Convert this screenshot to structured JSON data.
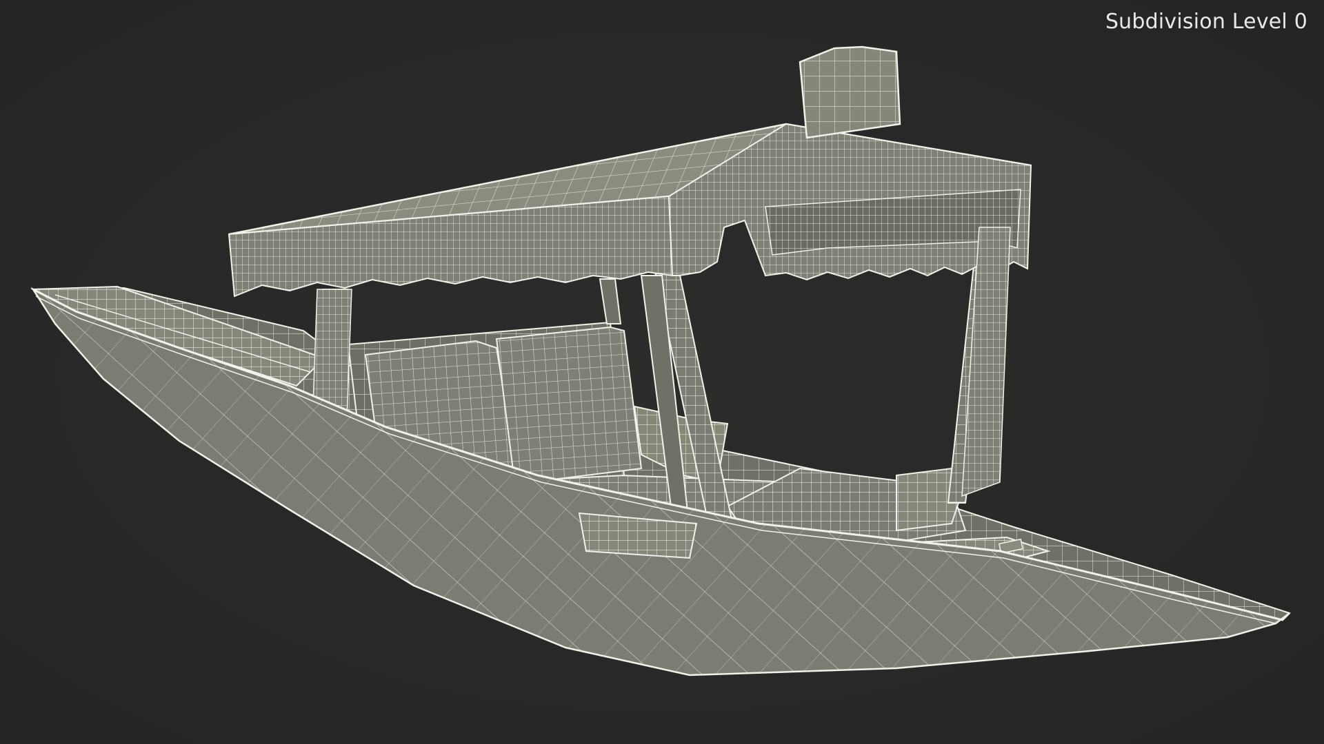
{
  "viewport": {
    "label": "Subdivision Level 0"
  },
  "colors": {
    "background": "#282827",
    "mesh_fill": "#7b7d72",
    "mesh_fill_light": "#8a8c80",
    "mesh_fill_dark": "#66685e",
    "wire": "#f2f2ea",
    "label": "#e9e9e9"
  },
  "icons": {
    "model": "shikara-boat-wireframe"
  }
}
